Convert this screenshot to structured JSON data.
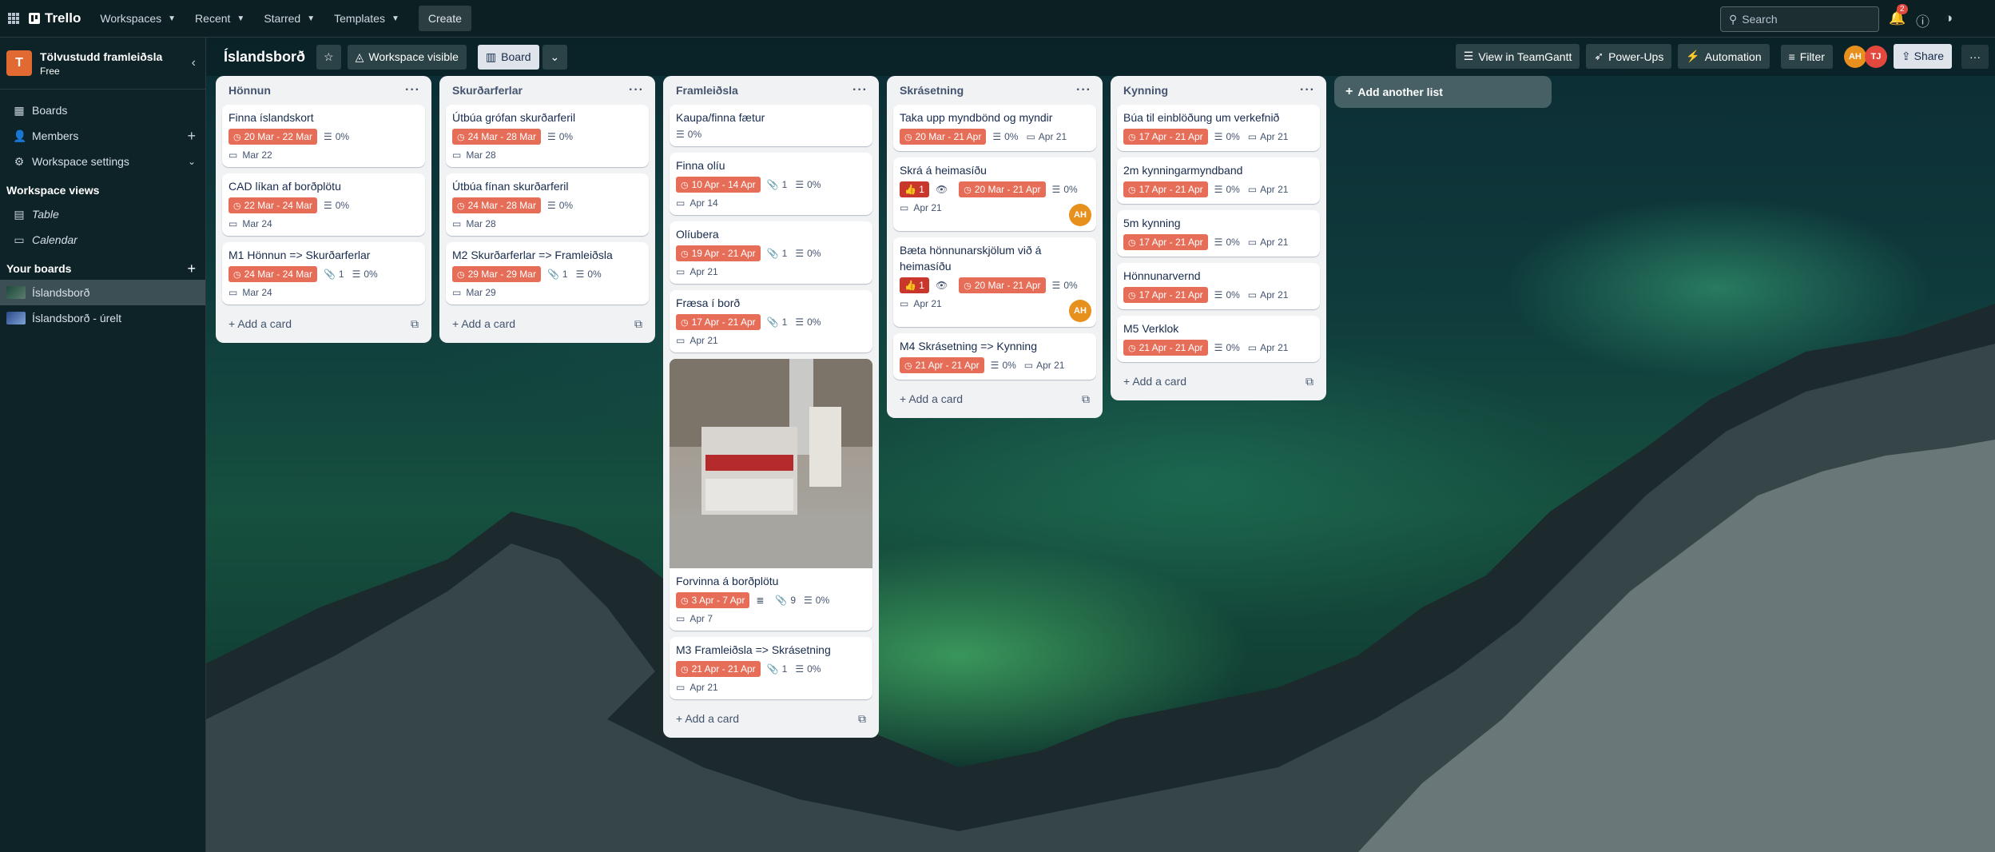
{
  "topbar": {
    "logo_text": "Trello",
    "nav": [
      "Workspaces",
      "Recent",
      "Starred",
      "Templates"
    ],
    "create_label": "Create",
    "search_placeholder": "Search",
    "notification_count": "2"
  },
  "boardbar": {
    "title": "Íslandsborð",
    "visibility_label": "Workspace visible",
    "view_label": "Board",
    "teamgantt_label": "View in TeamGantt",
    "powerups_label": "Power-Ups",
    "automation_label": "Automation",
    "filter_label": "Filter",
    "members": [
      {
        "initials": "AH",
        "color": "#e8901d"
      },
      {
        "initials": "TJ",
        "color": "#e2483d"
      }
    ],
    "share_label": "Share"
  },
  "sidebar": {
    "workspace_initial": "T",
    "workspace_name": "Tölvustudd framleiðsla",
    "workspace_plan": "Free",
    "items": [
      "Boards",
      "Members",
      "Workspace settings"
    ],
    "views_heading": "Workspace views",
    "views": [
      "Table",
      "Calendar"
    ],
    "boards_heading": "Your boards",
    "boards": [
      "Íslandsborð",
      "Íslandsborð - úrelt"
    ]
  },
  "lists": [
    {
      "title": "Hönnun",
      "cards": [
        {
          "title": "Finna íslandskort",
          "date": "20 Mar - 22 Mar",
          "checklist": "0%",
          "due": "Mar 22"
        },
        {
          "title": "CAD líkan af borðplötu",
          "date": "22 Mar - 24 Mar",
          "checklist": "0%",
          "due": "Mar 24"
        },
        {
          "title": "M1 Hönnun => Skurðarferlar",
          "date": "24 Mar - 24 Mar",
          "attachments": "1",
          "checklist": "0%",
          "due": "Mar 24"
        }
      ]
    },
    {
      "title": "Skurðarferlar",
      "cards": [
        {
          "title": "Útbúa grófan skurðarferil",
          "date": "24 Mar - 28 Mar",
          "checklist": "0%",
          "due": "Mar 28"
        },
        {
          "title": "Útbúa fínan skurðarferil",
          "date": "24 Mar - 28 Mar",
          "checklist": "0%",
          "due": "Mar 28"
        },
        {
          "title": "M2 Skurðarferlar => Framleiðsla",
          "date": "29 Mar - 29 Mar",
          "attachments": "1",
          "checklist": "0%",
          "due": "Mar 29"
        }
      ]
    },
    {
      "title": "Framleiðsla",
      "cards": [
        {
          "title": "Kaupa/finna fætur",
          "checklist": "0%"
        },
        {
          "title": "Finna olíu",
          "date": "10 Apr - 14 Apr",
          "attachments": "1",
          "checklist": "0%",
          "due": "Apr 14"
        },
        {
          "title": "Olíubera",
          "date": "19 Apr - 21 Apr",
          "attachments": "1",
          "checklist": "0%",
          "due": "Apr 21"
        },
        {
          "title": "Fræsa í borð",
          "date": "17 Apr - 21 Apr",
          "attachments": "1",
          "checklist": "0%",
          "due": "Apr 21"
        },
        {
          "title": "Forvinna á borðplötu",
          "date": "3 Apr - 7 Apr",
          "description": true,
          "attachments": "9",
          "checklist": "0%",
          "due": "Apr 7",
          "cover": true
        },
        {
          "title": "M3 Framleiðsla => Skrásetning",
          "date": "21 Apr - 21 Apr",
          "attachments": "1",
          "checklist": "0%",
          "due": "Apr 21"
        }
      ]
    },
    {
      "title": "Skrásetning",
      "cards": [
        {
          "title": "Taka upp myndbönd og myndir",
          "date": "20 Mar - 21 Apr",
          "checklist": "0%",
          "due_inline": "Apr 21"
        },
        {
          "title": "Skrá á heimasíðu",
          "votes": "1",
          "watch": true,
          "date": "20 Mar - 21 Apr",
          "checklist": "0%",
          "due": "Apr 21",
          "member": "AH"
        },
        {
          "title": "Bæta hönnunarskjölum við á heimasíðu",
          "votes": "1",
          "watch": true,
          "date": "20 Mar - 21 Apr",
          "checklist": "0%",
          "due": "Apr 21",
          "member": "AH"
        },
        {
          "title": "M4 Skrásetning => Kynning",
          "date": "21 Apr - 21 Apr",
          "checklist": "0%",
          "due_inline": "Apr 21"
        }
      ]
    },
    {
      "title": "Kynning",
      "cards": [
        {
          "title": "Búa til einblöðung um verkefnið",
          "date": "17 Apr - 21 Apr",
          "checklist": "0%",
          "due_inline": "Apr 21"
        },
        {
          "title": "2m kynningarmyndband",
          "date": "17 Apr - 21 Apr",
          "checklist": "0%",
          "due_inline": "Apr 21"
        },
        {
          "title": "5m kynning",
          "date": "17 Apr - 21 Apr",
          "checklist": "0%",
          "due_inline": "Apr 21"
        },
        {
          "title": "Hönnunarvernd",
          "date": "17 Apr - 21 Apr",
          "checklist": "0%",
          "due_inline": "Apr 21"
        },
        {
          "title": "M5 Verklok",
          "date": "21 Apr - 21 Apr",
          "checklist": "0%",
          "due_inline": "Apr 21"
        }
      ]
    }
  ],
  "add_card_label": "Add a card",
  "add_list_label": "Add another list",
  "colors": {
    "date_badge": "#e66e58",
    "vote_badge": "#c9372c",
    "workspace_logo": "#e06a32"
  }
}
